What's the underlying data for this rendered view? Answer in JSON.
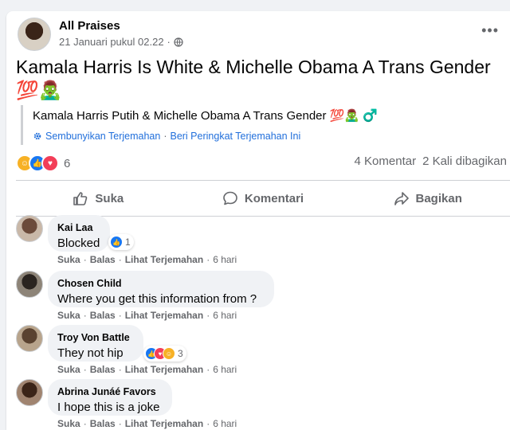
{
  "post": {
    "author": "All Praises",
    "timestamp": "21 Januari pukul 02.22",
    "more_label": "•••",
    "title": "Kamala Harris Is White & Michelle Obama A Trans Gender 💯🧟‍♂️",
    "translation_text": "Kamala Harris Putih & Michelle Obama A Trans Gender 💯🧟‍♂️ ♂️",
    "hide_translation": "Sembunyikan Terjemahan",
    "rate_translation": "Beri Peringkat Terjemahan Ini",
    "separator": "·",
    "reaction_count": "6",
    "comments_count": "4 Komentar",
    "shares_count": "2 Kali dibagikan"
  },
  "actions": {
    "like": "Suka",
    "comment": "Komentari",
    "share": "Bagikan"
  },
  "comment_meta": {
    "like": "Suka",
    "reply": "Balas",
    "translate": "Lihat Terjemahan",
    "sep": "·"
  },
  "comments": [
    {
      "name": "Kai Laa",
      "text": "Blocked",
      "reactions": "1",
      "time": "6 hari"
    },
    {
      "name": "Chosen Child",
      "text": "Where you get this information from ?",
      "reactions": "",
      "time": "6 hari"
    },
    {
      "name": "Troy Von Battle",
      "text": "They not hip",
      "reactions": "3",
      "time": "6 hari"
    },
    {
      "name": "Abrina Junáé Favors",
      "text": "I hope this is a joke",
      "reactions": "",
      "time": "6 hari"
    }
  ],
  "colors": {
    "link": "#216fdb",
    "muted": "#65676b",
    "like": "#1877f2",
    "love": "#f33e58",
    "haha": "#f7b125"
  },
  "icons": {
    "globe": "globe-icon",
    "gear": "gear-icon",
    "like": "thumbs-up-icon",
    "comment": "speech-bubble-icon",
    "share": "share-arrow-icon"
  }
}
